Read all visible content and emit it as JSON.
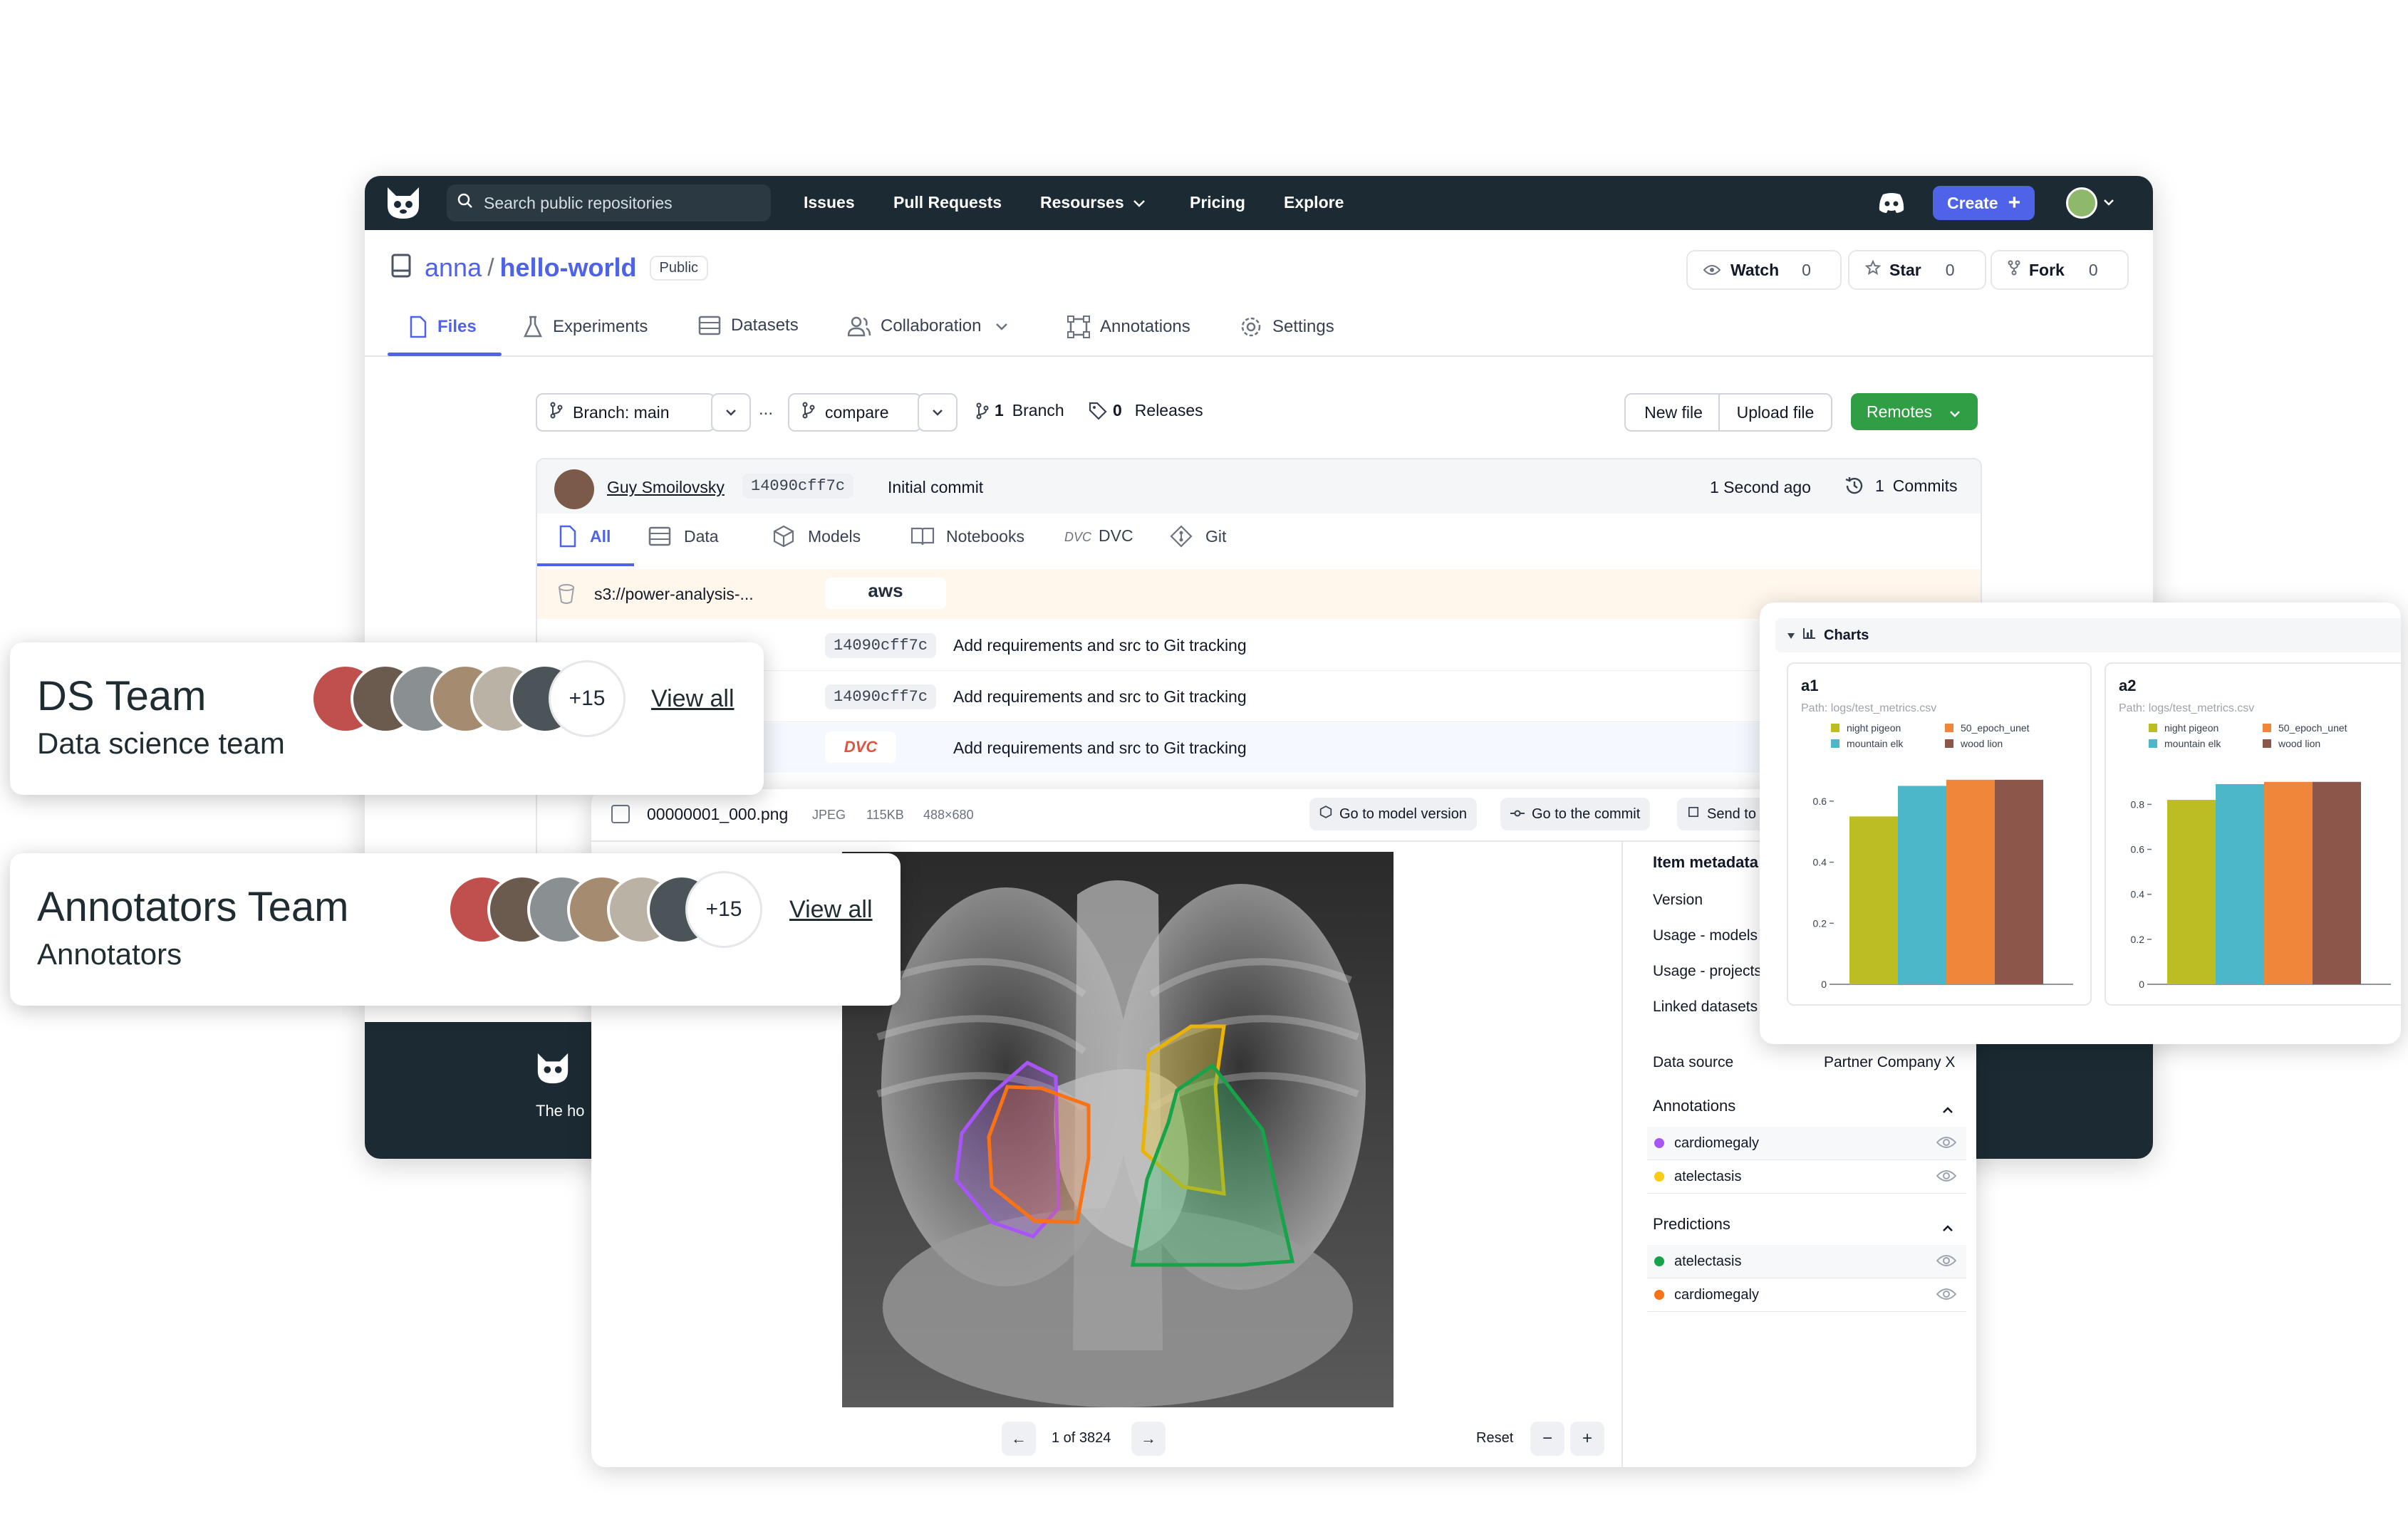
{
  "topbar": {
    "search_placeholder": "Search public repositories",
    "nav": [
      "Issues",
      "Pull Requests",
      "Resourses",
      "Pricing",
      "Explore"
    ],
    "create_label": "Create"
  },
  "repo": {
    "owner": "anna",
    "separator": "/",
    "name": "hello-world",
    "visibility": "Public",
    "watch_label": "Watch",
    "watch_count": "0",
    "star_label": "Star",
    "star_count": "0",
    "fork_label": "Fork",
    "fork_count": "0"
  },
  "tabs": [
    "Files",
    "Experiments",
    "Datasets",
    "Collaboration",
    "Annotations",
    "Settings"
  ],
  "toolbar": {
    "branch_label": "Branch: main",
    "ellipsis": "...",
    "compare_label": "compare",
    "branch_count": "1",
    "branch_word": "Branch",
    "release_count": "0",
    "release_word": "Releases",
    "new_file": "New file",
    "upload_file": "Upload file",
    "remotes": "Remotes"
  },
  "commit": {
    "author": "Guy Smoilovsky",
    "hash": "14090cff7c",
    "message": "Initial commit",
    "time": "1  Second ago",
    "commits_count": "1",
    "commits_word": "Commits"
  },
  "file_tabs": [
    "All",
    "Data",
    "Models",
    "Notebooks",
    "DVC",
    "Git"
  ],
  "files": [
    {
      "name": "s3://power-analysis-...",
      "badge": "aws"
    },
    {
      "hash": "14090cff7c",
      "message": "Add requirements and src to Git tracking"
    },
    {
      "hash": "14090cff7c",
      "message": "Add requirements and src to Git tracking"
    },
    {
      "badge": "DVC",
      "message": "Add requirements and src to Git tracking"
    }
  ],
  "teams": [
    {
      "title": "DS Team",
      "subtitle": "Data science team",
      "more": "+15",
      "view_all": "View all"
    },
    {
      "title": "Annotators Team",
      "subtitle": "Annotators",
      "more": "+15",
      "view_all": "View all"
    }
  ],
  "footer": {
    "tagline": "The ho"
  },
  "viewer": {
    "filename": "00000001_000.png",
    "format": "JPEG",
    "size": "115KB",
    "dims": "488×680",
    "btn_model": "Go to model version",
    "btn_commit": "Go to the commit",
    "btn_send": "Send to",
    "metadata_title": "Item metadata",
    "metadata_rows": [
      "Version",
      "Usage - models",
      "Usage - projects",
      "Linked datasets"
    ],
    "data_source_label": "Data source",
    "data_source_value": "Partner Company X",
    "annotations_title": "Annotations",
    "annotations": [
      {
        "label": "cardiomegaly",
        "color": "#a855f7"
      },
      {
        "label": "atelectasis",
        "color": "#facc15"
      }
    ],
    "predictions_title": "Predictions",
    "predictions": [
      {
        "label": "atelectasis",
        "color": "#16a34a"
      },
      {
        "label": "cardiomegaly",
        "color": "#f97316"
      }
    ],
    "pager": "1 of 3824",
    "reset": "Reset",
    "minus": "−",
    "plus": "+"
  },
  "charts_panel": {
    "title": "Charts"
  },
  "chart_data": [
    {
      "type": "bar",
      "title": "a1",
      "subtitle": "Path: logs/test_metrics.csv",
      "categories": [
        ""
      ],
      "series": [
        {
          "name": "night pigeon",
          "values": [
            0.55
          ],
          "color": "#bcbd22"
        },
        {
          "name": "mountain elk",
          "values": [
            0.65
          ],
          "color": "#4bb7c8"
        },
        {
          "name": "50_epoch_unet",
          "values": [
            0.67
          ],
          "color": "#f0863a"
        },
        {
          "name": "wood lion",
          "values": [
            0.67
          ],
          "color": "#8c564b"
        }
      ],
      "yticks": [
        "0",
        "0.2",
        "0.4",
        "0.6"
      ],
      "ylim": [
        0,
        0.7
      ]
    },
    {
      "type": "bar",
      "title": "a2",
      "subtitle": "Path: logs/test_metrics.csv",
      "categories": [
        ""
      ],
      "series": [
        {
          "name": "night pigeon",
          "values": [
            0.82
          ],
          "color": "#bcbd22"
        },
        {
          "name": "mountain elk",
          "values": [
            0.89
          ],
          "color": "#4bb7c8"
        },
        {
          "name": "50_epoch_unet",
          "values": [
            0.9
          ],
          "color": "#f0863a"
        },
        {
          "name": "wood lion",
          "values": [
            0.9
          ],
          "color": "#8c564b"
        }
      ],
      "yticks": [
        "0",
        "0.2",
        "0.4",
        "0.6",
        "0.8"
      ],
      "ylim": [
        0,
        0.95
      ]
    }
  ]
}
